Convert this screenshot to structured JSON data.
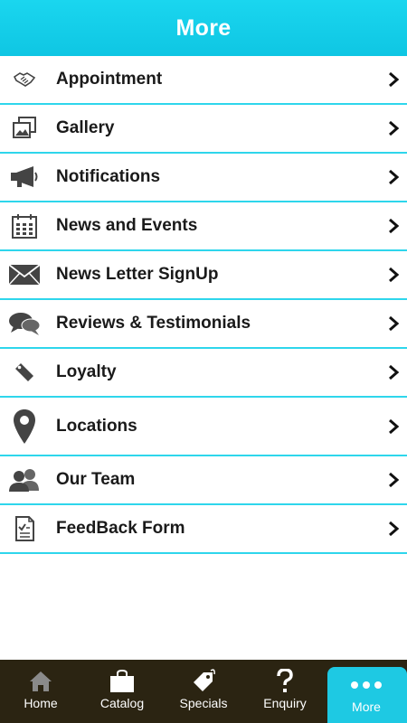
{
  "header": {
    "title": "More"
  },
  "menu": {
    "items": [
      {
        "label": "Appointment",
        "icon": "handshake-icon"
      },
      {
        "label": "Gallery",
        "icon": "gallery-icon"
      },
      {
        "label": "Notifications",
        "icon": "megaphone-icon"
      },
      {
        "label": "News and Events",
        "icon": "calendar-icon"
      },
      {
        "label": "News Letter SignUp",
        "icon": "envelope-icon"
      },
      {
        "label": "Reviews & Testimonials",
        "icon": "speech-bubbles-icon"
      },
      {
        "label": "Loyalty",
        "icon": "tag-icon"
      },
      {
        "label": "Locations",
        "icon": "map-pin-icon"
      },
      {
        "label": "Our Team",
        "icon": "people-icon"
      },
      {
        "label": "FeedBack Form",
        "icon": "feedback-form-icon"
      }
    ]
  },
  "tabbar": {
    "tabs": [
      {
        "label": "Home",
        "icon": "home-icon"
      },
      {
        "label": "Catalog",
        "icon": "shopping-bag-icon"
      },
      {
        "label": "Specials",
        "icon": "price-tag-icon"
      },
      {
        "label": "Enquiry",
        "icon": "question-mark-icon"
      },
      {
        "label": "More",
        "icon": "more-dots-icon",
        "active": true
      }
    ]
  },
  "colors": {
    "accent": "#1ec9e3",
    "header": "#12cbe6",
    "tabbar_bg": "#2b2412",
    "divider": "#2ed6ec",
    "text": "#1a1a1a"
  }
}
